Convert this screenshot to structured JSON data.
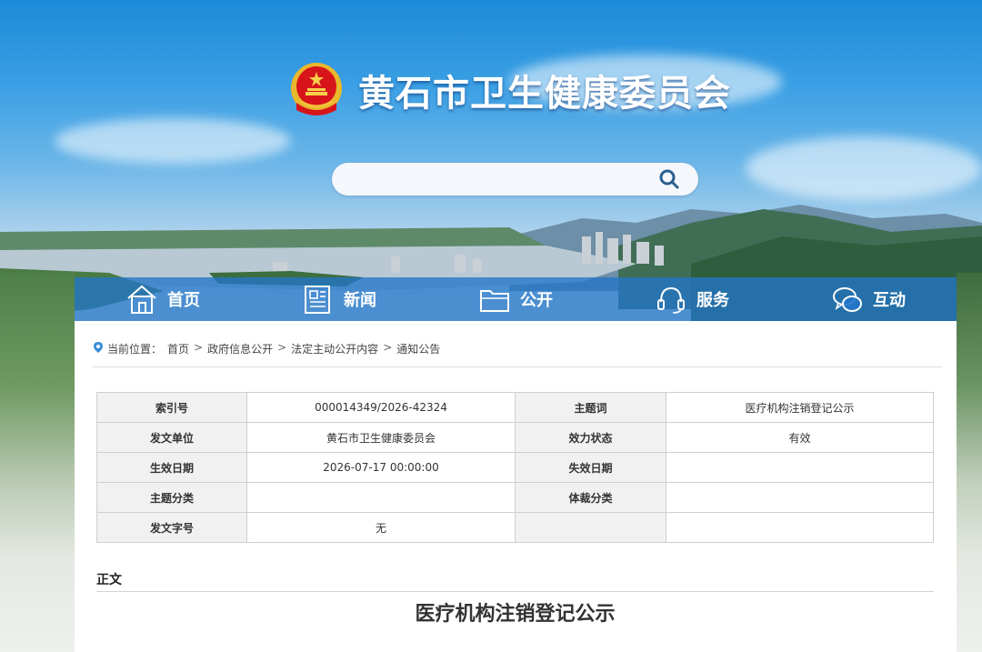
{
  "header": {
    "site_title": "黄石市卫生健康委员会",
    "search": {
      "value": "",
      "placeholder": ""
    }
  },
  "nav": [
    {
      "label": "首页",
      "icon": "home-icon"
    },
    {
      "label": "新闻",
      "icon": "newspaper-icon"
    },
    {
      "label": "公开",
      "icon": "folder-icon"
    },
    {
      "label": "服务",
      "icon": "headset-icon"
    },
    {
      "label": "互动",
      "icon": "chat-bubbles-icon"
    }
  ],
  "breadcrumb": {
    "prefix": "当前位置：",
    "items": [
      "首页",
      "政府信息公开",
      "法定主动公开内容",
      "通知公告"
    ],
    "separator": ">"
  },
  "meta_table": {
    "rows": [
      [
        {
          "k": "索引号",
          "v": "000014349/2026-42324"
        },
        {
          "k": "主题词",
          "v": "医疗机构注销登记公示"
        }
      ],
      [
        {
          "k": "发文单位",
          "v": "黄石市卫生健康委员会"
        },
        {
          "k": "效力状态",
          "v": "有效"
        }
      ],
      [
        {
          "k": "生效日期",
          "v": "2026-07-17 00:00:00"
        },
        {
          "k": "失效日期",
          "v": ""
        }
      ],
      [
        {
          "k": "主题分类",
          "v": ""
        },
        {
          "k": "体裁分类",
          "v": ""
        }
      ],
      [
        {
          "k": "发文字号",
          "v": "无"
        },
        {
          "k": "",
          "v": ""
        }
      ]
    ]
  },
  "body": {
    "section_label": "正文",
    "doc_title": "医疗机构注销登记公示"
  },
  "colors": {
    "nav_bg": "#2376c8",
    "sky_top": "#1c8ad8",
    "table_key_bg": "#f1f1f1",
    "emblem_red": "#d8141b",
    "emblem_gold": "#f2c23a"
  }
}
